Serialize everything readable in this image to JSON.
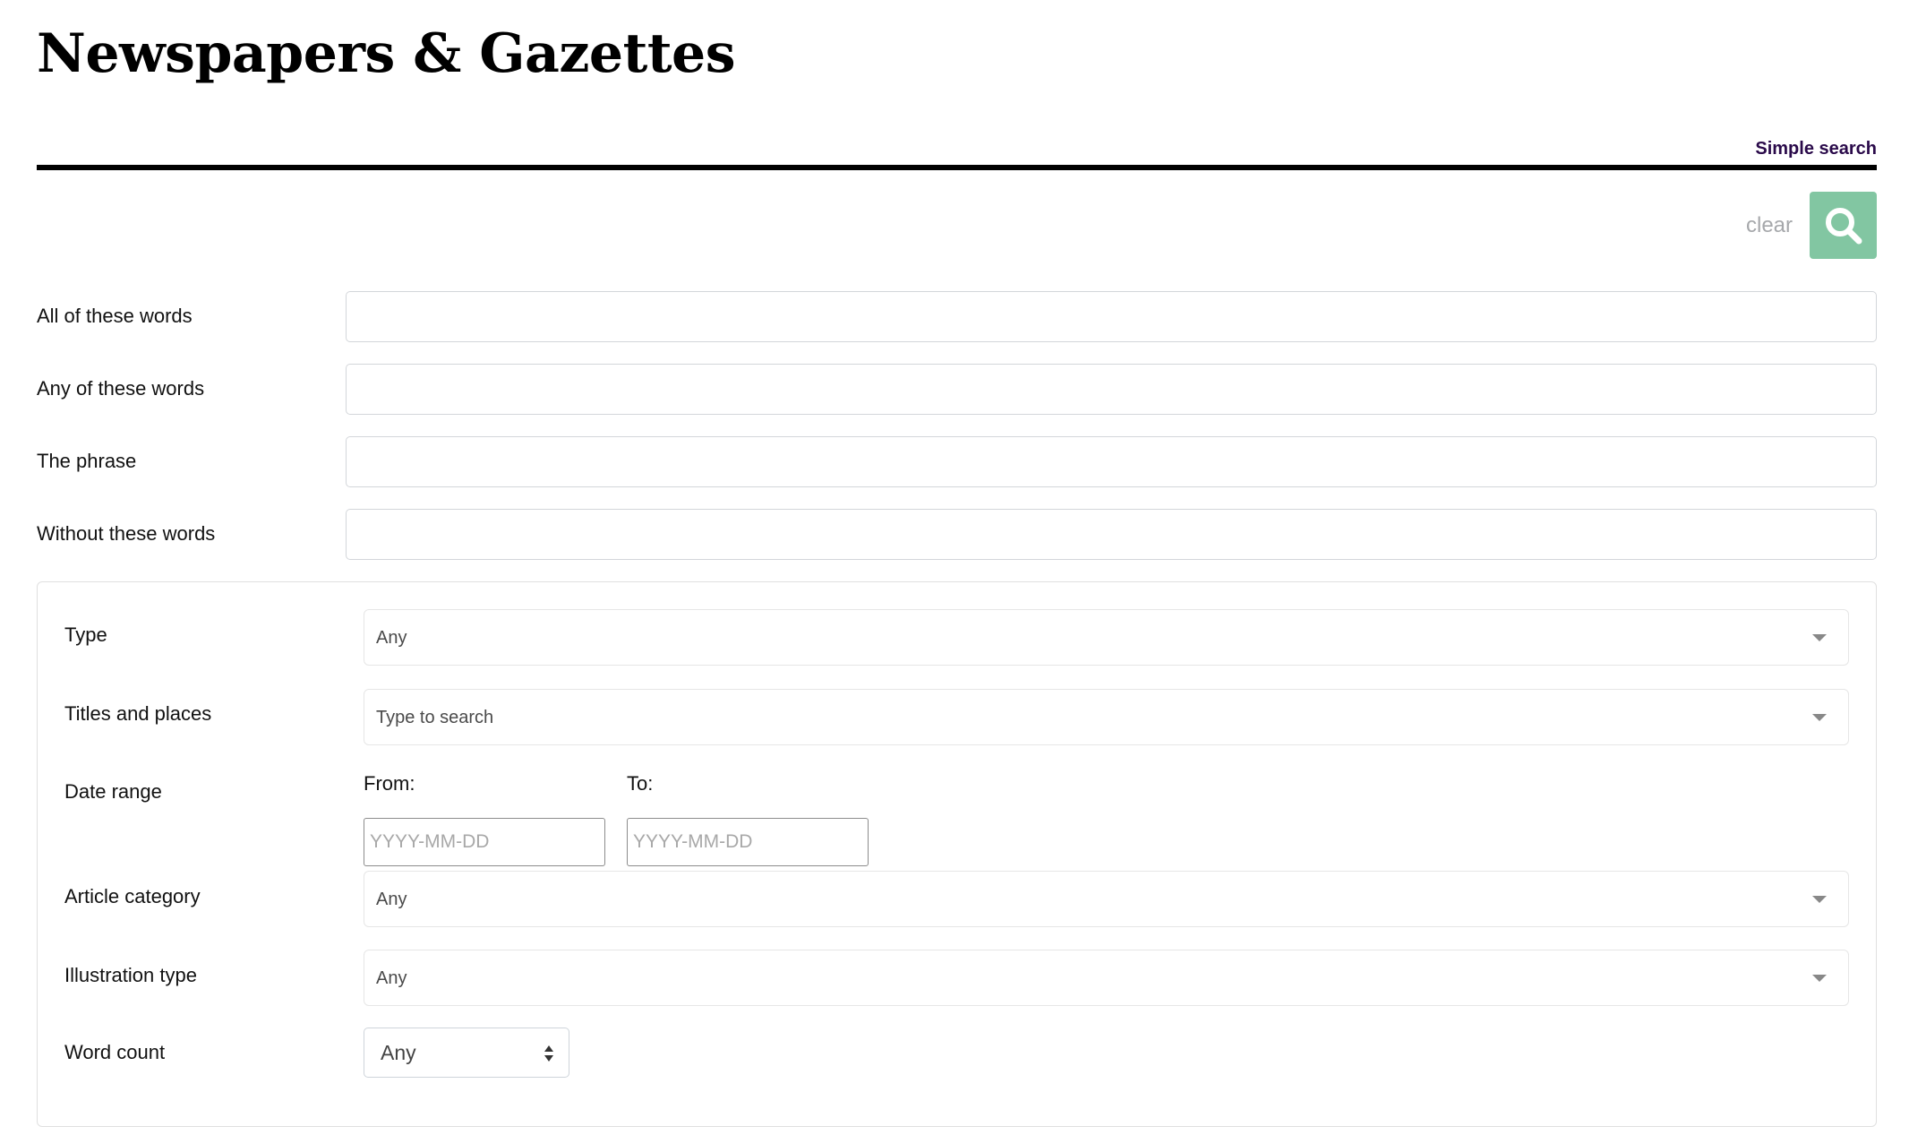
{
  "header": {
    "title": "Newspapers & Gazettes",
    "simple_search_label": "Simple search"
  },
  "actions": {
    "clear_label": "clear",
    "search_button_icon": "search-icon",
    "accent_color": "#82c6a2"
  },
  "keyword_fields": [
    {
      "label": "All of these words",
      "value": ""
    },
    {
      "label": "Any of these words",
      "value": ""
    },
    {
      "label": "The phrase",
      "value": ""
    },
    {
      "label": "Without these words",
      "value": ""
    }
  ],
  "filters": {
    "type": {
      "label": "Type",
      "value": "Any"
    },
    "titles_places": {
      "label": "Titles and places",
      "placeholder": "Type to search"
    },
    "date_range": {
      "label": "Date range",
      "from_label": "From:",
      "to_label": "To:",
      "from_placeholder": "YYYY-MM-DD",
      "to_placeholder": "YYYY-MM-DD",
      "from_value": "",
      "to_value": ""
    },
    "article_category": {
      "label": "Article category",
      "value": "Any"
    },
    "illustration_type": {
      "label": "Illustration type",
      "value": "Any"
    },
    "word_count": {
      "label": "Word count",
      "value": "Any"
    }
  }
}
